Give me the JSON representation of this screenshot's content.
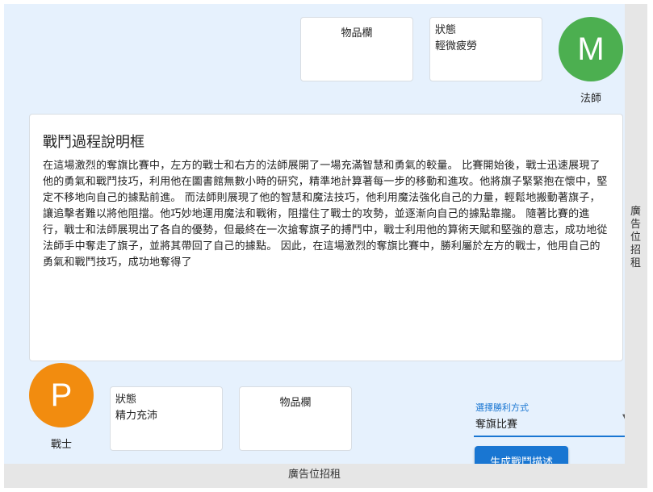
{
  "mage": {
    "avatar_letter": "M",
    "name": "法師",
    "color": "#4caf50",
    "inventory_label": "物品欄",
    "status_label": "狀態",
    "status_value": "輕微疲勞"
  },
  "warrior": {
    "avatar_letter": "P",
    "name": "戰士",
    "color": "#f28c0f",
    "inventory_label": "物品欄",
    "status_label": "狀態",
    "status_value": "精力充沛"
  },
  "battle": {
    "title": "戰鬥過程說明框",
    "description": "在這場激烈的奪旗比賽中，左方的戰士和右方的法師展開了一場充滿智慧和勇氣的較量。 比賽開始後，戰士迅速展現了他的勇氣和戰鬥技巧，利用他在圖書館無數小時的研究，精準地計算著每一步的移動和進攻。他將旗子緊緊抱在懷中，堅定不移地向自己的據點前進。 而法師則展現了他的智慧和魔法技巧，他利用魔法強化自己的力量，輕鬆地搬動著旗子，讓追擊者難以將他阻擋。他巧妙地運用魔法和戰術，阻擋住了戰士的攻勢，並逐漸向自己的據點靠攏。 隨著比賽的進行，戰士和法師展現出了各自的優勢，但最終在一次搶奪旗子的搏鬥中，戰士利用他的算術天賦和堅強的意志，成功地從法師手中奪走了旗子，並將其帶回了自己的據點。 因此，在這場激烈的奪旗比賽中，勝利屬於左方的戰士，他用自己的勇氣和戰鬥技巧，成功地奪得了"
  },
  "win_mode": {
    "label": "選擇勝利方式",
    "value": "奪旗比賽"
  },
  "generate_button": "生成戰鬥描述",
  "ads": {
    "right": "廣告位招租",
    "bottom": "廣告位招租"
  }
}
